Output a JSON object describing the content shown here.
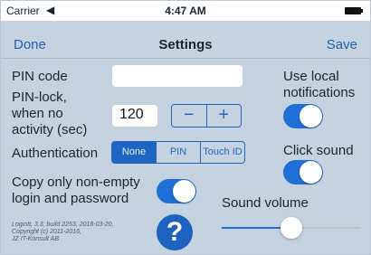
{
  "status_bar": {
    "carrier": "Carrier",
    "wifi_icon": "wifi-icon",
    "time": "4:47 AM",
    "battery_icon": "battery-icon"
  },
  "nav": {
    "done": "Done",
    "title": "Settings",
    "save": "Save"
  },
  "pin_code": {
    "label": "PIN code",
    "value": "",
    "placeholder": ""
  },
  "pin_lock": {
    "label_line1": "PIN-lock,",
    "label_line2": "when no",
    "label_line3": "activity (sec)",
    "value": "120",
    "decrement": "−",
    "increment": "+"
  },
  "authentication": {
    "label": "Authentication",
    "options": [
      "None",
      "PIN",
      "Touch ID"
    ],
    "selected": "None"
  },
  "copy_only": {
    "label_line1": "Copy only non-empty",
    "label_line2": "login and password",
    "enabled": true
  },
  "use_local_notifications": {
    "label_line1": "Use local",
    "label_line2": "notifications",
    "enabled": true
  },
  "click_sound": {
    "label": "Click sound",
    "enabled": true
  },
  "sound_volume": {
    "label": "Sound volume",
    "value": 0.5
  },
  "version_info": {
    "line1": "LoginIt, 3.3, build 2253, 2016-03-20,",
    "line2": "Copyright (c) 2011-2016,",
    "line3": "JZ IT-Konsult AB"
  },
  "help_button": {
    "glyph": "?"
  },
  "colors": {
    "accent": "#1f6fd6",
    "background": "#c5d3e1",
    "nav_link": "#1f5fb0"
  }
}
